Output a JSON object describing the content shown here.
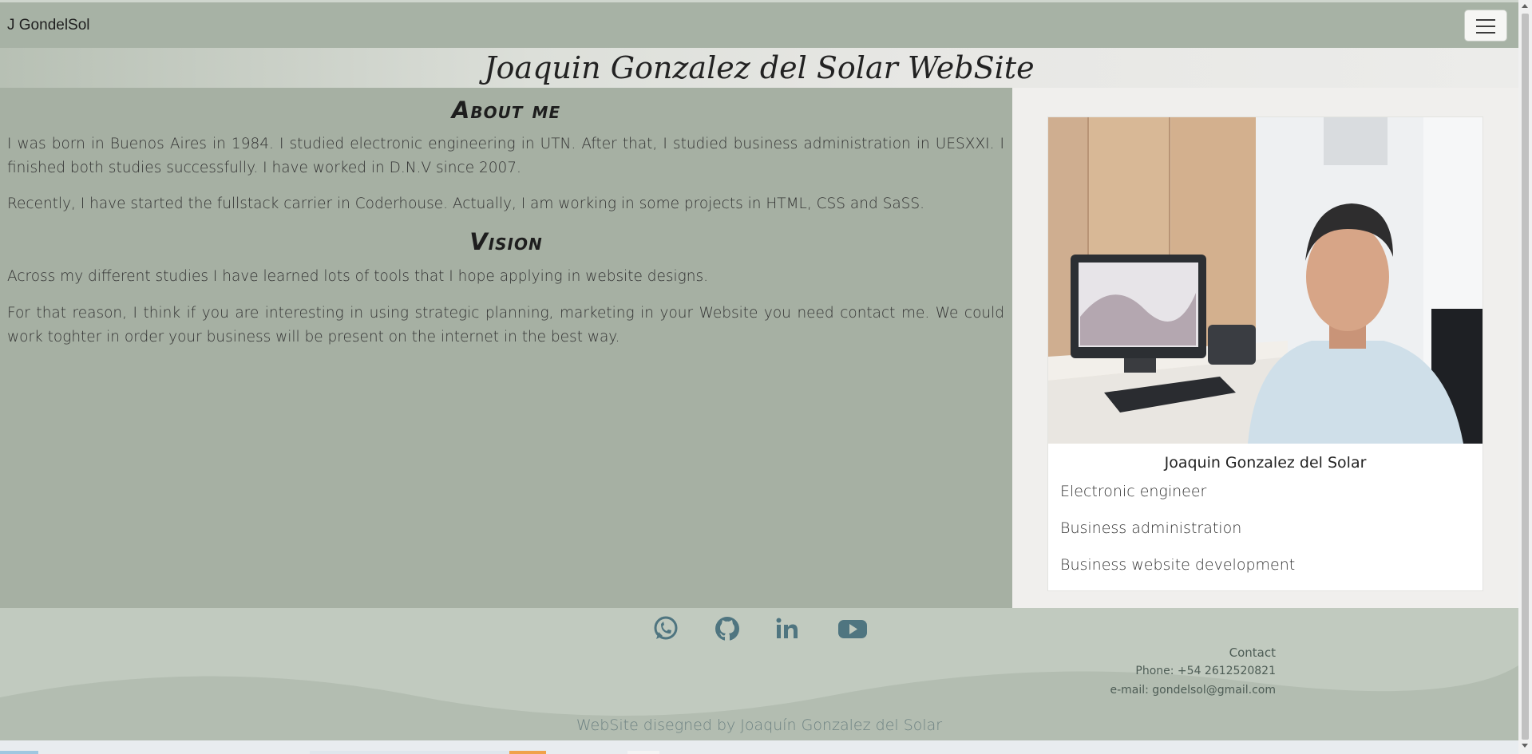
{
  "navbar": {
    "brand": "J GondelSol",
    "menu_icon": "hamburger-menu-icon"
  },
  "header": {
    "site_title": "Joaquin Gonzalez del Solar WebSite"
  },
  "about": {
    "heading": "About me",
    "p1": "I was born in Buenos Aires in 1984. I studied electronic engineering in UTN. After that, I studied business administration in UESXXI. I finished both studies successfully. I have worked in D.N.V since 2007.",
    "p2": "Recently, I have started the fullstack carrier in Coderhouse. Actually, I am working in some projects in HTML, CSS and SaSS."
  },
  "vision": {
    "heading": "Vision",
    "p1": "Across my different studies I have learned lots of tools that I hope applying in website designs.",
    "p2": "For that reason, I think if you are interesting in using strategic planning, marketing in your Website you need contact me. We could work toghter in order your business will be present on the internet in the best way."
  },
  "profile_card": {
    "photo": "profile-photo",
    "name": "Joaquin Gonzalez del Solar",
    "items": [
      "Electronic engineer",
      "Business administration",
      "Business website development"
    ]
  },
  "footer": {
    "social": [
      {
        "icon": "whatsapp-icon"
      },
      {
        "icon": "github-icon"
      },
      {
        "icon": "linkedin-icon"
      },
      {
        "icon": "youtube-icon"
      }
    ],
    "contact_title": "Contact",
    "phone": "Phone: +54 2612520821",
    "email": "e-mail: gondelsol@gmail.com",
    "credit": "WebSite disegned by Joaquín Gonzalez del Solar"
  },
  "colors": {
    "page_bg": "#a6b0a3",
    "footer_bg": "#c1cabf",
    "icon_color": "#4f7580",
    "card_bg": "#ffffff"
  }
}
